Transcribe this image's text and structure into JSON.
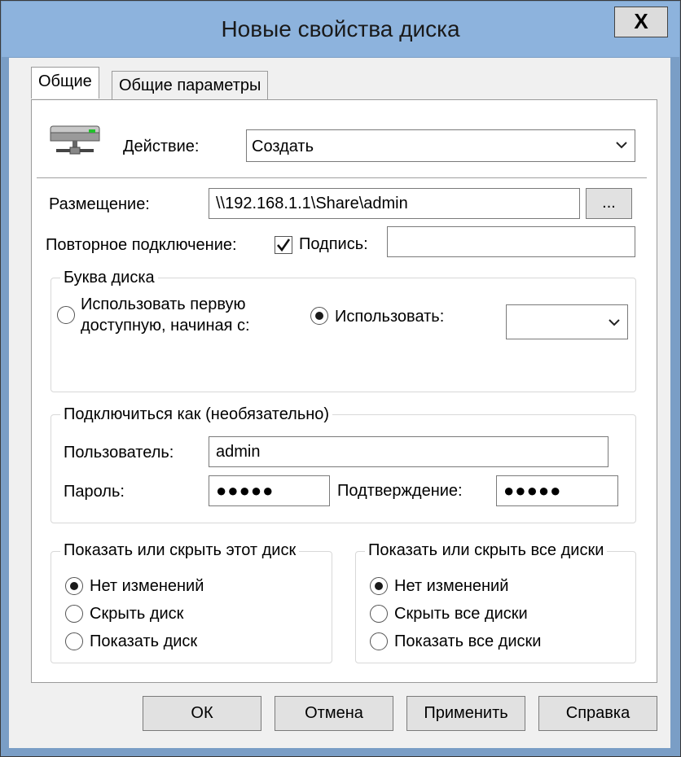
{
  "window": {
    "title": "Новые свойства диска",
    "close_label": "X"
  },
  "tabs": [
    {
      "label": "Общие"
    },
    {
      "label": "Общие параметры"
    }
  ],
  "general": {
    "action_label": "Действие:",
    "action_value": "Создать",
    "location_label": "Размещение:",
    "location_value": "\\\\192.168.1.1\\Share\\admin",
    "browse_label": "...",
    "reconnect_label": "Повторное подключение:",
    "reconnect_checked": true,
    "caption_label": "Подпись:",
    "caption_value": ""
  },
  "drive_letter": {
    "group_title": "Буква диска",
    "first_available_label_line1": "Использовать первую",
    "first_available_label_line2": "доступную, начиная с:",
    "use_label": "Использовать:",
    "selected": "use",
    "use_value": ""
  },
  "connect_as": {
    "group_title": "Подключиться как (необязательно)",
    "user_label": "Пользователь:",
    "user_value": "admin",
    "password_label": "Пароль:",
    "password_value": "●●●●●",
    "confirm_label": "Подтверждение:",
    "confirm_value": "●●●●●"
  },
  "show_hide_this": {
    "group_title": "Показать или скрыть этот диск",
    "options": [
      "Нет изменений",
      "Скрыть диск",
      "Показать диск"
    ],
    "selected_index": 0
  },
  "show_hide_all": {
    "group_title": "Показать или скрыть все диски",
    "options": [
      "Нет изменений",
      "Скрыть все диски",
      "Показать все диски"
    ],
    "selected_index": 0
  },
  "buttons": {
    "ok": "ОК",
    "cancel": "Отмена",
    "apply": "Применить",
    "help": "Справка"
  },
  "icons": {
    "drive": "network-drive-icon",
    "chevron": "chevron-down-icon"
  }
}
